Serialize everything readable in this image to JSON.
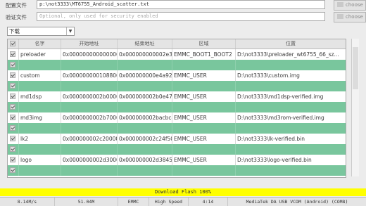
{
  "scatter_row": {
    "label": "配置文件",
    "path": "p:\\not3333\\MT6755_Android_scatter.txt",
    "button": "choose"
  },
  "auth_row": {
    "label": "验证文件",
    "placeholder": "Optional, only used for security enabled",
    "button": "choose"
  },
  "mode_select": {
    "value": "下载"
  },
  "table": {
    "headers": [
      "名字",
      "开始地址",
      "结束地址",
      "区域",
      "位置"
    ],
    "rows": [
      {
        "name": "preloader",
        "start": "0x0000000000000000",
        "end": "0x000000000002e3cf",
        "region": "EMMC_BOOT1_BOOT2",
        "location": "D:\\not3333\\preloader_wt6755_66_sz...",
        "style": "white"
      },
      {
        "name": "",
        "start": "",
        "end": "",
        "region": "",
        "location": "",
        "style": "green"
      },
      {
        "name": "custom",
        "start": "0x0000000001088000",
        "end": "0x000000000e4a92d3",
        "region": "EMMC_USER",
        "location": "D:\\not3333\\custom.img",
        "style": "white"
      },
      {
        "name": "",
        "start": "",
        "end": "",
        "region": "",
        "location": "",
        "style": "green"
      },
      {
        "name": "md1dsp",
        "start": "0x0000000002b000000",
        "end": "0x000000002b0e472f",
        "region": "EMMC_USER",
        "location": "D:\\not3333\\md1dsp-verified.img",
        "style": "white"
      },
      {
        "name": "",
        "start": "",
        "end": "",
        "region": "",
        "location": "",
        "style": "green"
      },
      {
        "name": "md3img",
        "start": "0x0000000002b700000",
        "end": "0x000000002bacbc4f",
        "region": "EMMC_USER",
        "location": "D:\\not3333\\md3rom-verified.img",
        "style": "white"
      },
      {
        "name": "",
        "start": "",
        "end": "",
        "region": "",
        "location": "",
        "style": "green"
      },
      {
        "name": "lk2",
        "start": "0x000000002c200000",
        "end": "0x000000002c24f50f",
        "region": "EMMC_USER",
        "location": "D:\\not3333\\lk-verified.bin",
        "style": "white"
      },
      {
        "name": "",
        "start": "",
        "end": "",
        "region": "",
        "location": "",
        "style": "green"
      },
      {
        "name": "logo",
        "start": "0x0000000002d300000",
        "end": "0x000000002d3845cf",
        "region": "EMMC_USER",
        "location": "D:\\not3333\\logo-verified.bin",
        "style": "white"
      },
      {
        "name": "",
        "start": "",
        "end": "",
        "region": "",
        "location": "",
        "style": "green"
      }
    ]
  },
  "progress": {
    "text": "Download Flash 100%",
    "fraction": 1.0,
    "color": "#ffff00"
  },
  "status_bar": [
    "8.14M/s",
    "51.04M",
    "EMMC",
    "High Speed",
    "4:14",
    "MediaTek DA USB VCOM (Android) (COM8)"
  ],
  "colors": {
    "flashed_row": "#79c69d"
  }
}
